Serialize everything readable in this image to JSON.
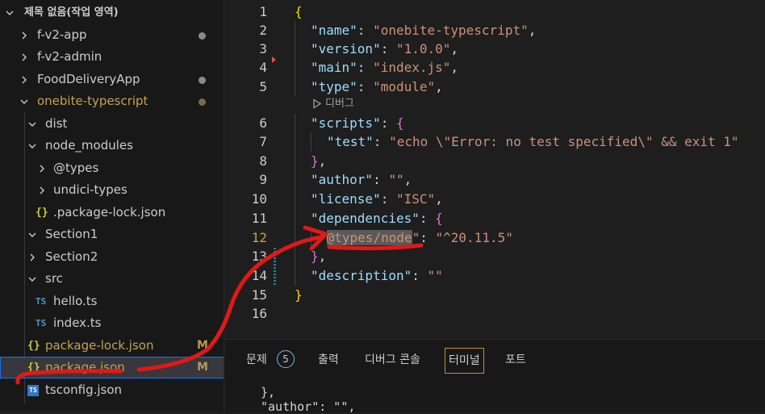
{
  "sidebar": {
    "workspace": "제목 없음(작업 영역)",
    "items": [
      {
        "label": "f-v2-app",
        "color": "#cccccc",
        "modified": true
      },
      {
        "label": "f-v2-admin",
        "color": "#cccccc",
        "modified": false
      },
      {
        "label": "FoodDeliveryApp",
        "color": "#cccccc",
        "modified": true
      },
      {
        "label": "onebite-typescript",
        "color": "#c6a24f",
        "modified": true
      },
      {
        "label": "dist"
      },
      {
        "label": "node_modules"
      },
      {
        "label": "@types"
      },
      {
        "label": "undici-types"
      },
      {
        "label": ".package-lock.json"
      },
      {
        "label": "Section1"
      },
      {
        "label": "Section2"
      },
      {
        "label": "src"
      },
      {
        "label": "hello.ts"
      },
      {
        "label": "index.ts"
      },
      {
        "label": "package-lock.json",
        "badge": "M"
      },
      {
        "label": "package.json",
        "badge": "M"
      },
      {
        "label": "tsconfig.json"
      }
    ],
    "ts_icon_text": "TS",
    "json_icon_text": "{}"
  },
  "editor": {
    "line_numbers": [
      "1",
      "2",
      "3",
      "4",
      "5",
      "6",
      "7",
      "8",
      "9",
      "10",
      "11",
      "12",
      "13",
      "14",
      "15",
      "16"
    ],
    "active_line": "12",
    "codelens": "디버그",
    "lines": {
      "l1_open": "{",
      "l2_key": "\"name\"",
      "l2_val": "\"onebite-typescript\"",
      "l3_key": "\"version\"",
      "l3_val": "\"1.0.0\"",
      "l4_key": "\"main\"",
      "l4_val": "\"index.js\"",
      "l5_key": "\"type\"",
      "l5_val": "\"module\"",
      "l6_key": "\"scripts\"",
      "l6_open": "{",
      "l7_key": "\"test\"",
      "l7_val": "\"echo \\\"Error: no test specified\\\" && exit 1\"",
      "l8_close": "}",
      "l9_key": "\"author\"",
      "l9_val": "\"\"",
      "l10_key": "\"license\"",
      "l10_val": "\"ISC\"",
      "l11_key": "\"dependencies\"",
      "l11_open": "{",
      "l12_q1": "\"",
      "l12_sel": "@types/node",
      "l12_q2": "\"",
      "l12_val": "\"^20.11.5\"",
      "l13_close": "}",
      "l14_key": "\"description\"",
      "l14_val": "\"\"",
      "l15_close": "}"
    }
  },
  "panel": {
    "tabs": [
      "문제",
      "출력",
      "디버그 콘솔",
      "터미널",
      "포트"
    ],
    "problems_count": "5",
    "active_tab": "터미널",
    "terminal_lines": [
      "},",
      "\"author\": \"\","
    ]
  },
  "colors": {
    "accent": "#c6a24f",
    "annotation": "#e01818",
    "string": "#ce9178",
    "key": "#9cdcfe"
  }
}
